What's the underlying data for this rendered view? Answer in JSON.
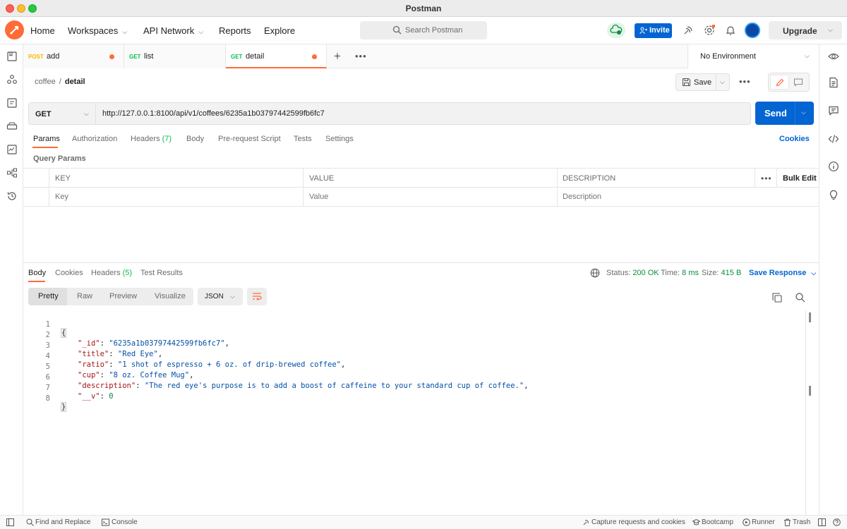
{
  "window": {
    "title": "Postman"
  },
  "header": {
    "nav": [
      {
        "label": "Home"
      },
      {
        "label": "Workspaces"
      },
      {
        "label": "API Network"
      },
      {
        "label": "Reports"
      },
      {
        "label": "Explore"
      }
    ],
    "search_placeholder": "Search Postman",
    "invite_label": "Invite",
    "upgrade_label": "Upgrade"
  },
  "tabs": [
    {
      "method": "POST",
      "name": "add",
      "unsaved": true
    },
    {
      "method": "GET",
      "name": "list",
      "unsaved": false
    },
    {
      "method": "GET",
      "name": "detail",
      "unsaved": true
    }
  ],
  "environment": "No Environment",
  "breadcrumb": {
    "collection": "coffee",
    "separator": "/",
    "request": "detail"
  },
  "toolbar": {
    "save_label": "Save"
  },
  "request": {
    "method": "GET",
    "url": "http://127.0.0.1:8100/api/v1/coffees/6235a1b03797442599fb6fc7",
    "send_label": "Send"
  },
  "request_tabs": {
    "params": "Params",
    "authorization": "Authorization",
    "headers": "Headers",
    "headers_count": "(7)",
    "body": "Body",
    "prerequest": "Pre-request Script",
    "tests": "Tests",
    "settings": "Settings",
    "cookies": "Cookies"
  },
  "query_params": {
    "title": "Query Params",
    "columns": [
      "KEY",
      "VALUE",
      "DESCRIPTION"
    ],
    "bulk_edit": "Bulk Edit",
    "placeholders": {
      "key": "Key",
      "value": "Value",
      "description": "Description"
    }
  },
  "response": {
    "tabs": {
      "body": "Body",
      "cookies": "Cookies",
      "headers": "Headers",
      "headers_count": "(5)",
      "test_results": "Test Results"
    },
    "status_label": "Status:",
    "status_value": "200 OK",
    "time_label": "Time:",
    "time_value": "8 ms",
    "size_label": "Size:",
    "size_value": "415 B",
    "save_response": "Save Response",
    "formats": [
      "Pretty",
      "Raw",
      "Preview",
      "Visualize"
    ],
    "language": "JSON",
    "body_lines": [
      {
        "n": "1",
        "key": "",
        "value": "",
        "text": "{"
      },
      {
        "n": "2",
        "key": "\"_id\"",
        "value": "\"6235a1b03797442599fb6fc7\"",
        "text": ","
      },
      {
        "n": "3",
        "key": "\"title\"",
        "value": "\"Red Eye\"",
        "text": ","
      },
      {
        "n": "4",
        "key": "\"ratio\"",
        "value": "\"1 shot of espresso + 6 oz. of drip-brewed coffee\"",
        "text": ","
      },
      {
        "n": "5",
        "key": "\"cup\"",
        "value": "\"8 oz. Coffee Mug\"",
        "text": ","
      },
      {
        "n": "6",
        "key": "\"description\"",
        "value": "\"The red eye's purpose is to add a boost of caffeine to your standard cup of coffee.\"",
        "text": ","
      },
      {
        "n": "7",
        "key": "\"__v\"",
        "value": "0",
        "text": ""
      },
      {
        "n": "8",
        "key": "",
        "value": "",
        "text": "}"
      }
    ]
  },
  "footer": {
    "find_replace": "Find and Replace",
    "console": "Console",
    "capture": "Capture requests and cookies",
    "bootcamp": "Bootcamp",
    "runner": "Runner",
    "trash": "Trash"
  },
  "colors": {
    "accent": "#ff6c37",
    "primary": "#0265d2",
    "get_method": "#0cbb52",
    "post_method": "#ffb400",
    "status_ok": "#0c8e3c"
  }
}
